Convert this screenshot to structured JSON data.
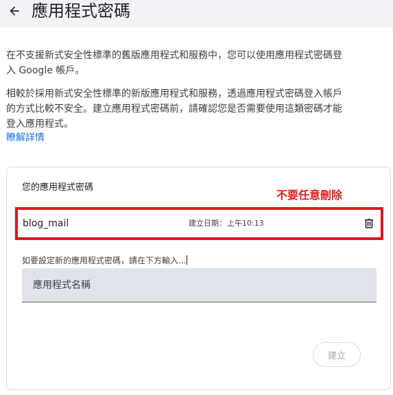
{
  "header": {
    "back_icon": "arrow-left-icon",
    "title": "應用程式密碼"
  },
  "intro": {
    "para1": "在不支援新式安全性標準的舊版應用程式和服務中，您可以使用應用程式密碼登入 Google 帳戶。",
    "para2": "相較於採用新式安全性標準的新版應用程式和服務，透過應用程式密碼登入帳戶的方式比較不安全。建立應用程式密碼前，請確認您是否需要使用這類密碼才能登入應用程式。",
    "learn_more": "瞭解詳情"
  },
  "card": {
    "title": "您的應用程式密碼",
    "annotation": "不要任意刪除",
    "annotation_color": "#e02020",
    "passwords": [
      {
        "name": "blog_mail",
        "created_label": "建立日期：",
        "created_time": "上午10:13",
        "delete_icon": "trash-icon"
      }
    ],
    "new_hint": "如要設定新的應用程式密碼，請在下方輸入...",
    "input_placeholder": "應用程式名稱",
    "input_value": "",
    "create_label": "建立"
  },
  "colors": {
    "header_bg": "#f1f3f7",
    "link": "#1a73e8",
    "highlight_border": "#e0141e",
    "input_bg": "#dfe3ea"
  }
}
